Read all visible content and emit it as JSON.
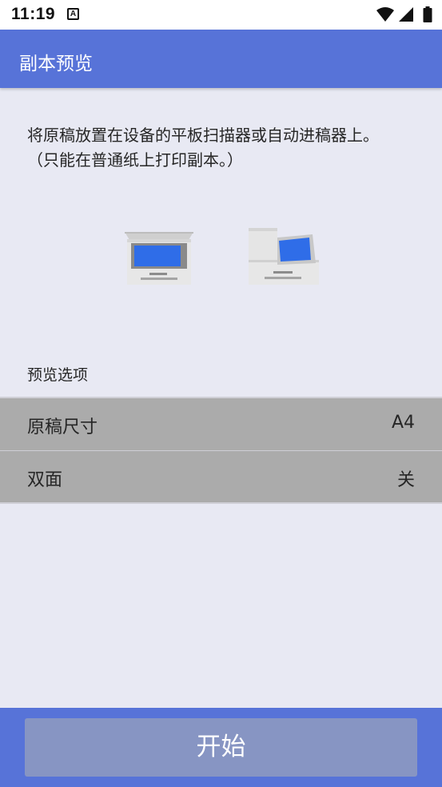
{
  "status_bar": {
    "time": "11:19",
    "notification_glyph": "A",
    "icons": [
      "wifi-icon",
      "cellular-signal-icon",
      "battery-icon"
    ]
  },
  "app_bar": {
    "title": "副本预览"
  },
  "instructions": {
    "line1": "将原稿放置在设备的平板扫描器或自动进稿器上。",
    "line2": "（只能在普通纸上打印副本。）"
  },
  "illustrations": [
    "flatbed-scanner-icon",
    "document-feeder-icon"
  ],
  "preview_options": {
    "section_label": "预览选项",
    "rows": [
      {
        "label": "原稿尺寸",
        "value": "A4"
      },
      {
        "label": "双面",
        "value": "关"
      }
    ]
  },
  "start_button": {
    "label": "开始"
  },
  "colors": {
    "primary": "#5773d8",
    "background": "#e8e9f3",
    "option_row": "#ababab",
    "button": "#8795c3",
    "scanner_screen": "#2f6de8"
  }
}
